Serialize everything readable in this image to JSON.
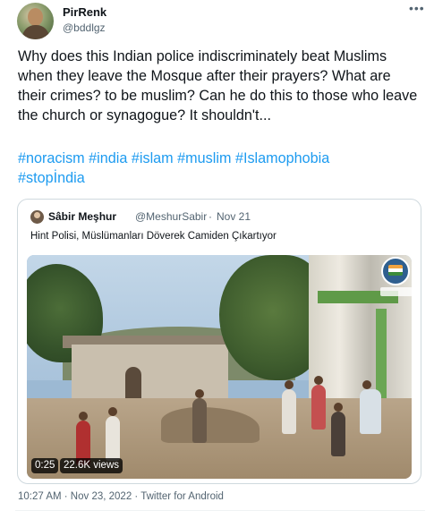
{
  "author": {
    "display_name": "PirRenk",
    "handle": "@bddlgz"
  },
  "tweet": {
    "text": "Why does this Indian police indiscriminately beat Muslims when they leave the Mosque after their prayers?  What are their crimes?  to be muslim?  Can he do this to those who leave the church or synagogue?  It shouldn't...",
    "hashtags": [
      "#noracism",
      "#india",
      "#islam",
      "#muslim",
      "#Islamophobia",
      "#stopİndia"
    ]
  },
  "quoted_tweet": {
    "display_name": "Sâbir Meşhur",
    "handle": "@MeshurSabir",
    "separator": "·",
    "date": "Nov 21",
    "text": "Hint Polisi, Müslümanları Döverek Camiden Çıkartıyor",
    "video": {
      "duration": "0:25",
      "views": "22.6K views"
    }
  },
  "footer": {
    "timestamp": "10:27 AM · Nov 23, 2022 · Twitter for Android"
  },
  "icons": {
    "more": "more-horizontal-icon"
  },
  "colors": {
    "text": "#0f1419",
    "secondary": "#536471",
    "link": "#1d9bf0",
    "border": "#cfd9de"
  }
}
